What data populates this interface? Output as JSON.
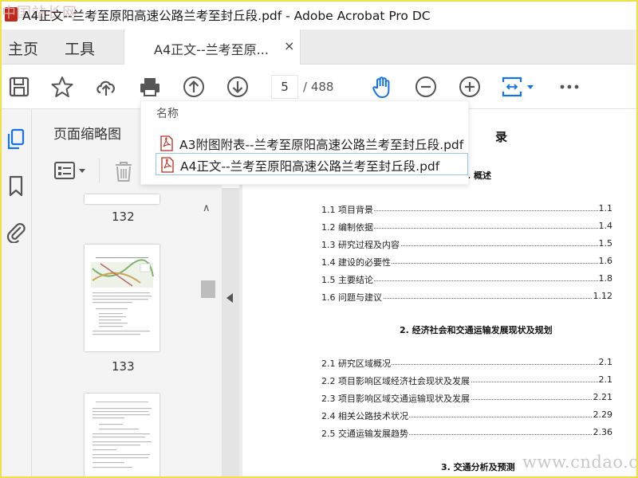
{
  "window": {
    "title": "A4正文--兰考至原阳高速公路兰考至封丘段.pdf - Adobe Acrobat Pro DC",
    "watermark_top": "中国站长网"
  },
  "tabs": {
    "home_label": "主页",
    "tools_label": "工具",
    "document_tab_label": "A4正文--兰考至原...",
    "close_symbol": "×"
  },
  "toolbar": {
    "current_page": "5",
    "total_pages": "/ 488",
    "accent_color": "#1473e6"
  },
  "popup": {
    "header": "名称",
    "files": [
      {
        "name": "A3附图附表--兰考至原阳高速公路兰考至封丘段.pdf"
      },
      {
        "name": "A4正文--兰考至原阳高速公路兰考至封丘段.pdf"
      }
    ]
  },
  "thumbnails": {
    "panel_title": "页面缩略图",
    "pages": [
      "132",
      "133"
    ]
  },
  "document": {
    "heading_fragment": "录",
    "section1_fragment": ". 概述",
    "section1_items": [
      {
        "label": "1.1 项目背景",
        "page": "1.1"
      },
      {
        "label": "1.2 编制依据",
        "page": "1.4"
      },
      {
        "label": "1.3 研究过程及内容",
        "page": "1.5"
      },
      {
        "label": "1.4 建设的必要性",
        "page": "1.6"
      },
      {
        "label": "1.5 主要结论",
        "page": "1.8"
      },
      {
        "label": "1.6 问题与建议",
        "page": "1.12"
      }
    ],
    "section2_title": "2. 经济社会和交通运输发展现状及规划",
    "section2_items": [
      {
        "label": "2.1 研究区域概况",
        "page": "2.1"
      },
      {
        "label": "2.2 项目影响区域经济社会现状及发展",
        "page": "2.1"
      },
      {
        "label": "2.3 项目影响区域交通运输现状及发展",
        "page": "2.21"
      },
      {
        "label": "2.4 相关公路技术状况",
        "page": "2.29"
      },
      {
        "label": "2.5 交通运输发展趋势",
        "page": "2.36"
      }
    ],
    "section3_title": "3. 交通分析及预测"
  },
  "watermark_bottom": "www.cndao.com"
}
